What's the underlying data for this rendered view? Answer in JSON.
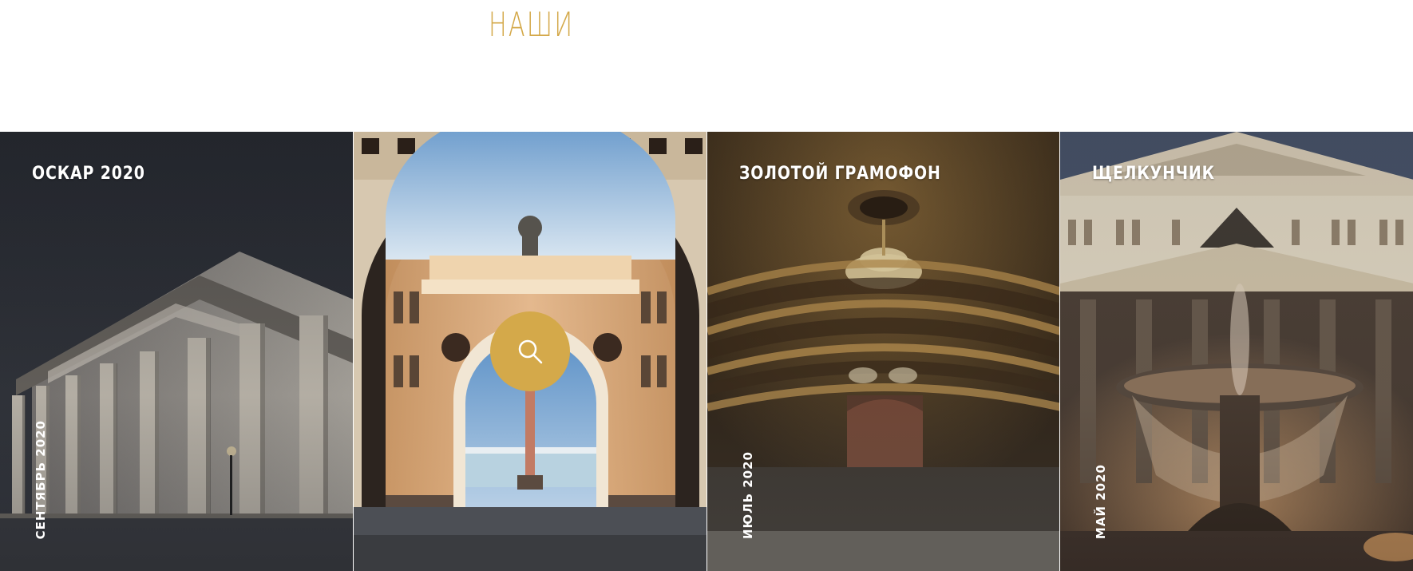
{
  "section": {
    "title": "НАШИ"
  },
  "cards": [
    {
      "title": "ОСКАР 2020",
      "date": "СЕНТЯБРЬ 2020"
    },
    {
      "title": "",
      "date": "",
      "action_icon": "search-icon"
    },
    {
      "title": "ЗОЛОТОЙ ГРАМОФОН",
      "date": "ИЮЛЬ 2020"
    },
    {
      "title": "ЩЕЛКУНЧИК",
      "date": "МАЙ 2020"
    }
  ],
  "colors": {
    "accent": "#d4a94a",
    "card_text": "#ffffff",
    "page_background": "#ffffff"
  }
}
